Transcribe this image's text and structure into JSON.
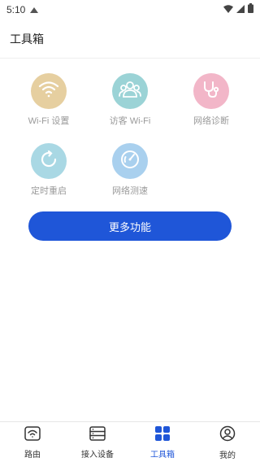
{
  "status_bar": {
    "time": "5:10",
    "left_icons": [
      "notification-icon"
    ],
    "right_icons": [
      "wifi-icon",
      "cellular-signal-icon",
      "battery-icon"
    ]
  },
  "header": {
    "title": "工具箱"
  },
  "tools": [
    {
      "label": "Wi-Fi 设置",
      "icon": "wifi-icon",
      "color": "#e6cfa0"
    },
    {
      "label": "访客 Wi-Fi",
      "icon": "guests-icon",
      "color": "#9bd3d6"
    },
    {
      "label": "网络诊断",
      "icon": "stethoscope-icon",
      "color": "#f2b6c8"
    },
    {
      "label": "定时重启",
      "icon": "refresh-icon",
      "color": "#a9d8e4"
    },
    {
      "label": "网络测速",
      "icon": "speedometer-icon",
      "color": "#a9d0ee"
    }
  ],
  "more_button": {
    "label": "更多功能",
    "color": "#1f56d8"
  },
  "tab_bar": {
    "active_color": "#1f56d8",
    "tabs": [
      {
        "label": "路由",
        "icon": "router-icon",
        "active": false
      },
      {
        "label": "接入设备",
        "icon": "devices-icon",
        "active": false
      },
      {
        "label": "工具箱",
        "icon": "toolbox-grid-icon",
        "active": true
      },
      {
        "label": "我的",
        "icon": "profile-icon",
        "active": false
      }
    ]
  }
}
